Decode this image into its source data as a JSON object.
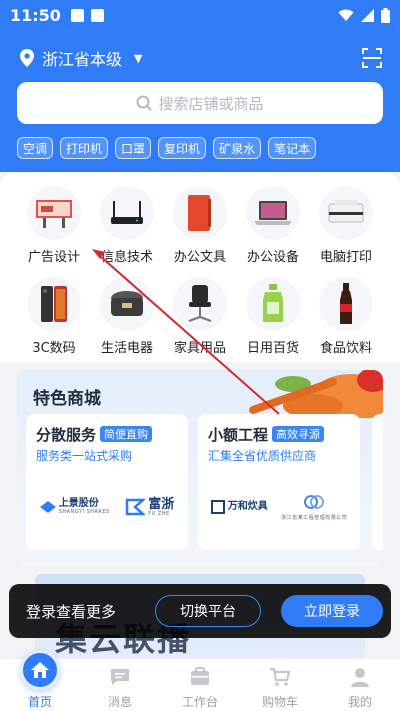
{
  "status_bar": {
    "time": "11:50"
  },
  "location": {
    "text": "浙江省本级"
  },
  "search": {
    "placeholder": "搜索店铺或商品"
  },
  "hot_chips": [
    "空调",
    "打印机",
    "口罩",
    "复印机",
    "矿泉水",
    "笔记本"
  ],
  "categories": [
    {
      "label": "广告设计",
      "icon": "billboard-icon"
    },
    {
      "label": "信息技术",
      "icon": "router-icon"
    },
    {
      "label": "办公文具",
      "icon": "notebook-icon"
    },
    {
      "label": "办公设备",
      "icon": "laptop-icon"
    },
    {
      "label": "电脑打印",
      "icon": "printer-icon"
    },
    {
      "label": "3C数码",
      "icon": "smartphone-icon"
    },
    {
      "label": "生活电器",
      "icon": "rice-cooker-icon"
    },
    {
      "label": "家具用品",
      "icon": "office-chair-icon"
    },
    {
      "label": "日用百货",
      "icon": "detergent-bottle-icon"
    },
    {
      "label": "食品饮料",
      "icon": "cola-bottle-icon"
    }
  ],
  "featured_mall": {
    "title": "特色商城",
    "cards": [
      {
        "title": "分散服务",
        "tag": "简便直购",
        "subtitle": "服务类一站式采购",
        "logos": [
          {
            "name": "上景股份",
            "small": "SHANGYI SHARES"
          },
          {
            "name": "富浙",
            "small": "FU ZHE"
          }
        ]
      },
      {
        "title": "小额工程",
        "tag": "高效寻源",
        "subtitle": "汇集全省优质供应商",
        "logos": [
          {
            "name": "万和炊具",
            "small": ""
          },
          {
            "name": "",
            "small": "浙江省某工程管理有限公司"
          }
        ]
      }
    ]
  },
  "banner": {
    "text": "集云联播"
  },
  "login_prompt": {
    "text": "登录查看更多",
    "switch_label": "切换平台",
    "login_label": "立即登录"
  },
  "tabbar": [
    {
      "label": "首页",
      "icon": "home-icon",
      "active": true
    },
    {
      "label": "消息",
      "icon": "message-icon",
      "active": false
    },
    {
      "label": "工作台",
      "icon": "workbench-icon",
      "active": false
    },
    {
      "label": "购物车",
      "icon": "cart-icon",
      "active": false
    },
    {
      "label": "我的",
      "icon": "user-icon",
      "active": false
    }
  ],
  "colors": {
    "primary": "#2f7cf6",
    "annotation_arrow": "#d62a2a"
  }
}
